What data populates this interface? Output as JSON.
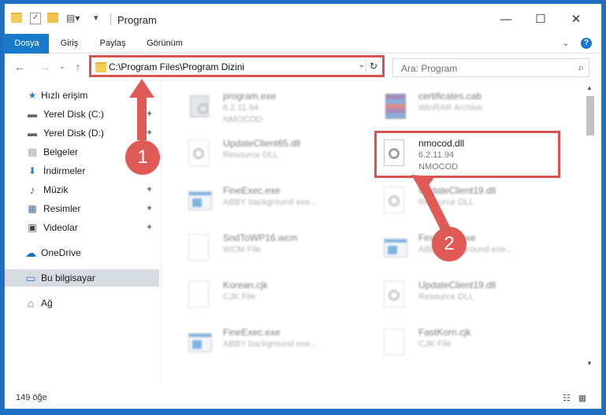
{
  "window": {
    "title": "Program",
    "minimize_glyph": "—",
    "maximize_glyph": "☐",
    "close_glyph": "✕"
  },
  "ribbon": {
    "tabs": [
      {
        "label": "Dosya"
      },
      {
        "label": "Giriş"
      },
      {
        "label": "Paylaş"
      },
      {
        "label": "Görünüm"
      }
    ],
    "expand_glyph": "⌄",
    "help_glyph": "?"
  },
  "nav": {
    "back_glyph": "←",
    "forward_glyph": "→",
    "recent_glyph": "⌄",
    "up_glyph": "↑"
  },
  "address": {
    "path": "C:\\Program Files\\Program Dizini",
    "dropdown_glyph": "⌄",
    "refresh_glyph": "↻"
  },
  "search": {
    "placeholder": "Ara: Program",
    "icon": "search-icon",
    "glyph": "⌕"
  },
  "sidebar": {
    "items": [
      {
        "label": "Hızlı erişim",
        "icon": "star-icon",
        "glyph": "★",
        "pinned": false
      },
      {
        "label": "Yerel Disk (C:)",
        "icon": "drive-icon",
        "glyph": "▬",
        "pinned": true
      },
      {
        "label": "Yerel Disk (D:)",
        "icon": "drive-icon",
        "glyph": "▬",
        "pinned": true
      },
      {
        "label": "Belgeler",
        "icon": "documents-icon",
        "glyph": "▤",
        "pinned": true
      },
      {
        "label": "İndirmeler",
        "icon": "download-icon",
        "glyph": "⬇",
        "pinned": true
      },
      {
        "label": "Müzik",
        "icon": "music-icon",
        "glyph": "♪",
        "pinned": true
      },
      {
        "label": "Resimler",
        "icon": "pictures-icon",
        "glyph": "▦",
        "pinned": true
      },
      {
        "label": "Videolar",
        "icon": "video-icon",
        "glyph": "▣",
        "pinned": true
      },
      {
        "label": "OneDrive",
        "icon": "cloud-icon",
        "glyph": "☁",
        "pinned": false
      },
      {
        "label": "Bu bilgisayar",
        "icon": "computer-icon",
        "glyph": "▭",
        "pinned": false
      },
      {
        "label": "Ağ",
        "icon": "network-icon",
        "glyph": "⌂",
        "pinned": false
      }
    ],
    "pin_glyph": "✦"
  },
  "files": [
    {
      "name": "program.exe",
      "sub1": "6.2.11.94",
      "sub2": "NMOCOD",
      "icon": "program-exe-icon"
    },
    {
      "name": "certificates.cab",
      "sub1": "WinRAR Archive",
      "sub2": "",
      "icon": "archive-icon"
    },
    {
      "name": "UpdateClient65.dll",
      "sub1": "Resource DLL",
      "sub2": "",
      "icon": "dll-icon"
    },
    {
      "name": "nmocod.dll",
      "sub1": "6.2.11.94",
      "sub2": "NMOCOD",
      "icon": "dll-icon"
    },
    {
      "name": "FineExec.exe",
      "sub1": "ABBY background exe...",
      "sub2": "",
      "icon": "exe-icon"
    },
    {
      "name": "UpdateClient19.dll",
      "sub1": "Resource DLL",
      "sub2": "",
      "icon": "dll-icon"
    },
    {
      "name": "SndToWP16.wcm",
      "sub1": "WCM File",
      "sub2": "",
      "icon": "file-icon"
    },
    {
      "name": "FineExec.exe",
      "sub1": "ABBY background exe...",
      "sub2": "",
      "icon": "exe-icon"
    },
    {
      "name": "Korean.cjk",
      "sub1": "CJK File",
      "sub2": "",
      "icon": "file-icon"
    },
    {
      "name": "UpdateClient19.dll",
      "sub1": "Resource DLL",
      "sub2": "",
      "icon": "dll-icon"
    },
    {
      "name": "FineExec.exe",
      "sub1": "ABBY background exe...",
      "sub2": "",
      "icon": "exe-icon"
    },
    {
      "name": "FastKorn.cjk",
      "sub1": "CJK File",
      "sub2": "",
      "icon": "file-icon"
    }
  ],
  "annotations": {
    "step1": "1",
    "step2": "2",
    "color": "#e05a55"
  },
  "status": {
    "count": "149 öğe",
    "details_glyph": "☷",
    "tiles_glyph": "▦"
  }
}
